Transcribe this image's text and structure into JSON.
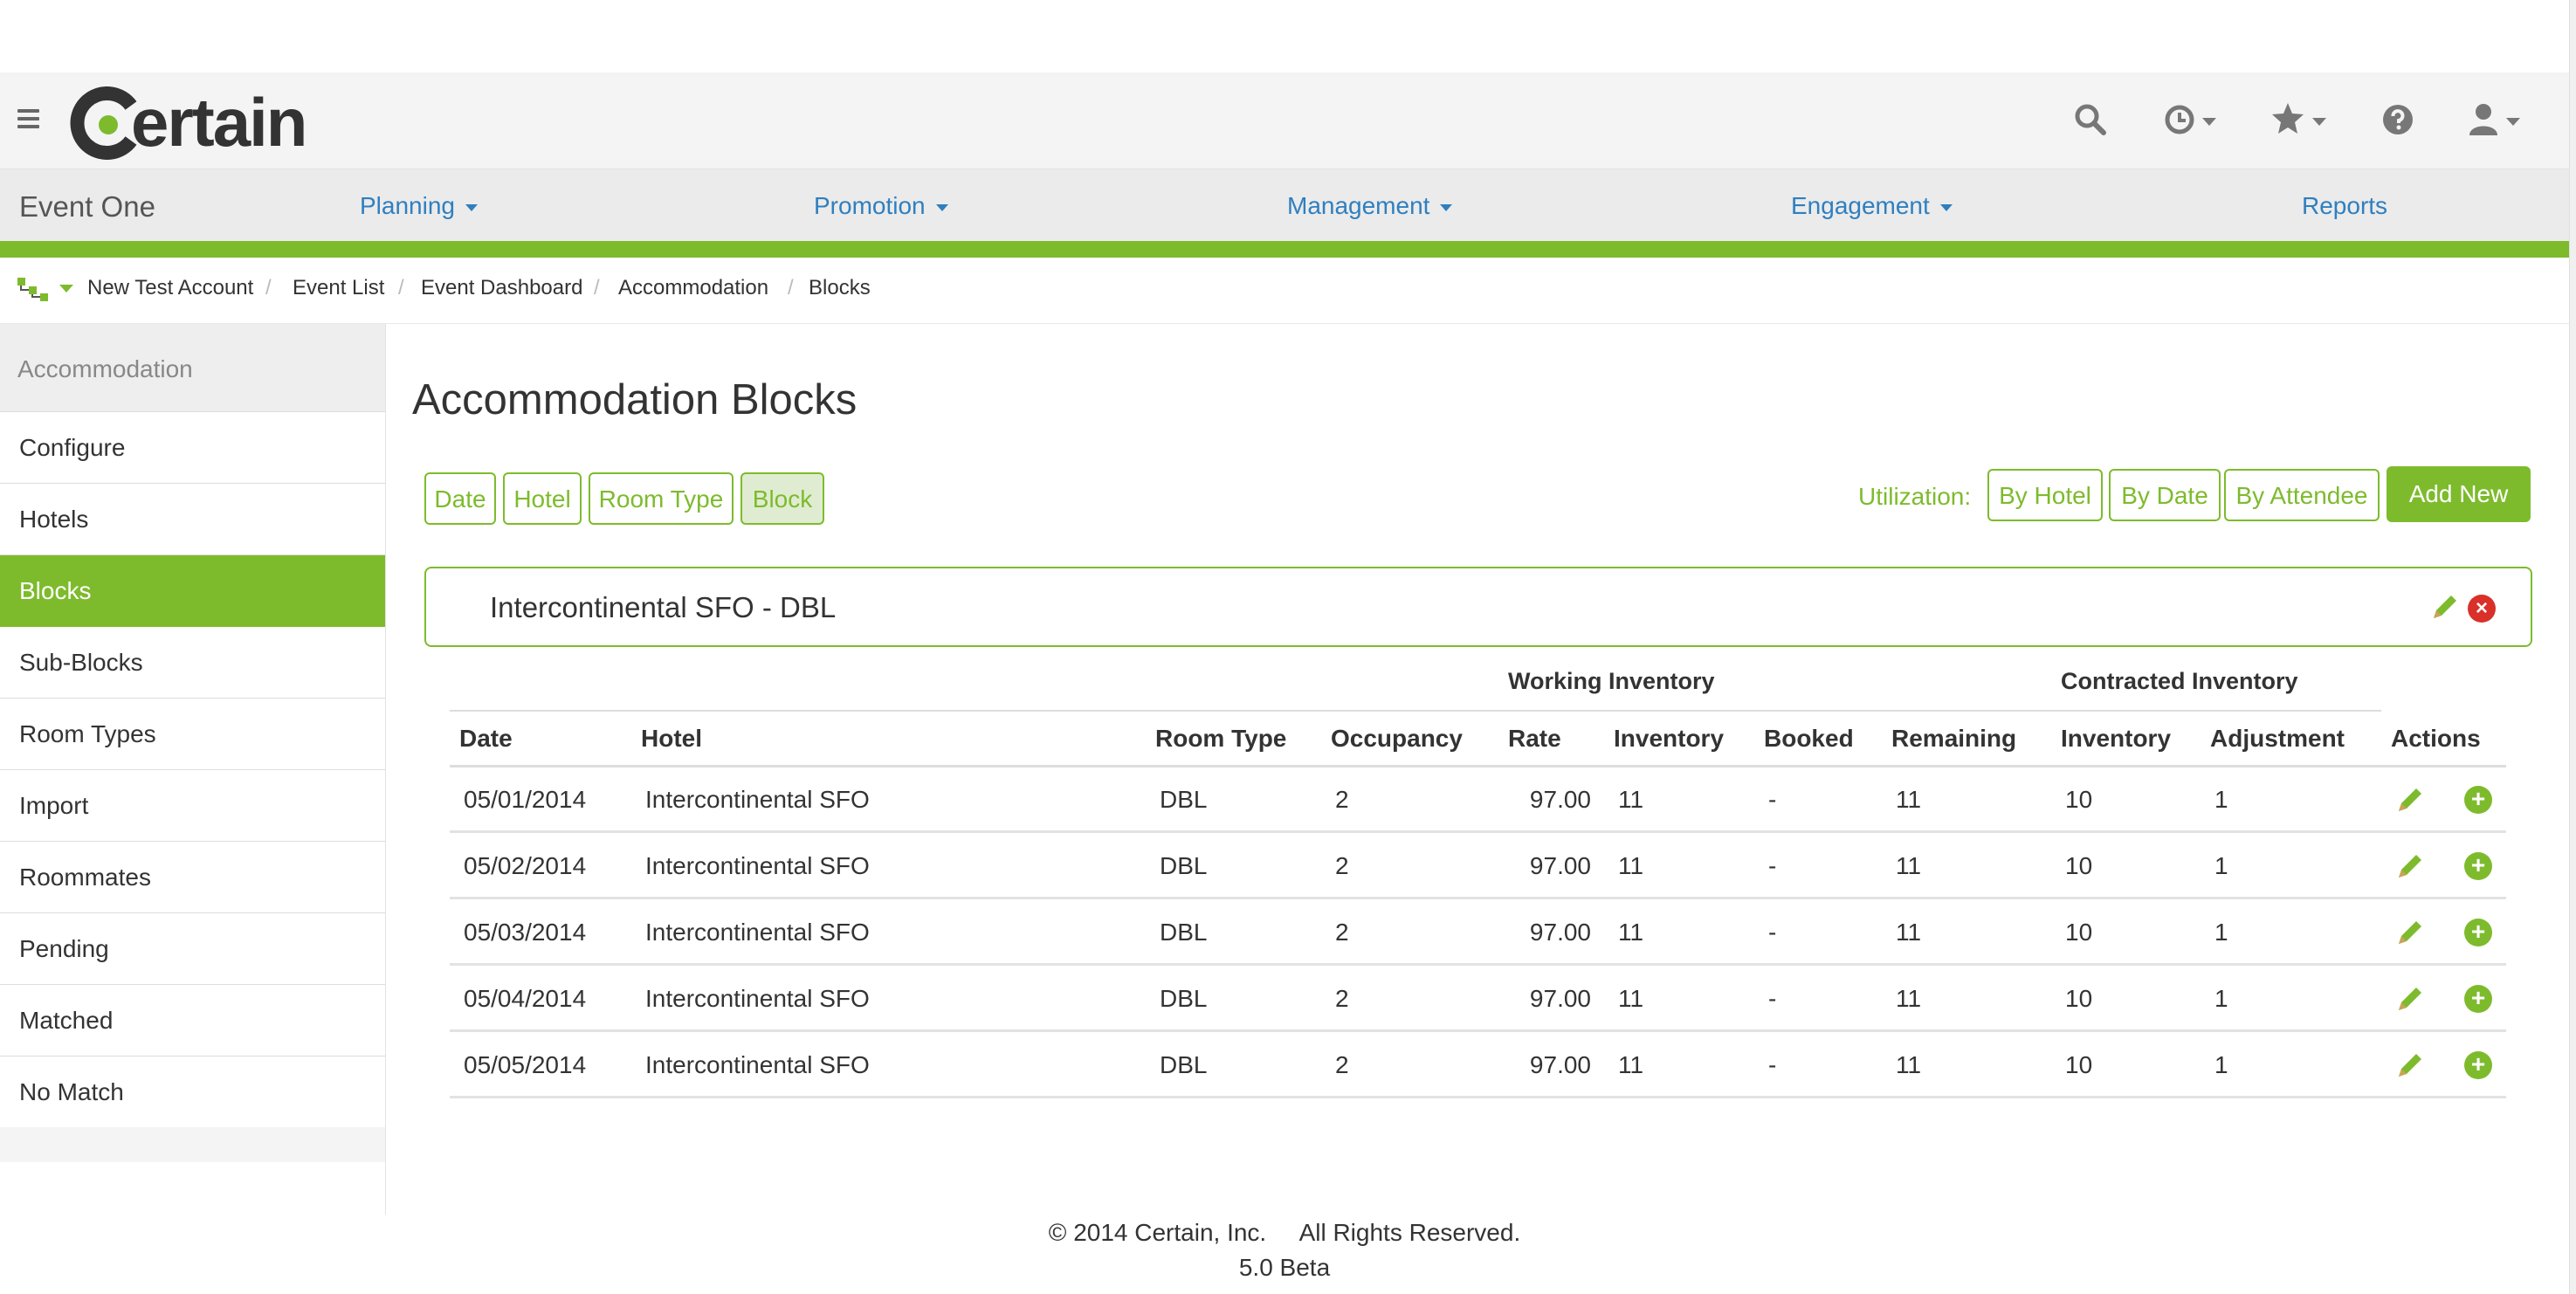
{
  "app": {
    "logo_text": "ertain",
    "brand_color": "#7dbb2d",
    "link_color": "#2f7fbf"
  },
  "header": {
    "icons": [
      "menu-icon",
      "search-icon",
      "history-icon",
      "star-icon",
      "help-icon",
      "user-icon"
    ]
  },
  "nav": {
    "event_name": "Event One",
    "items": [
      {
        "label": "Planning",
        "dropdown": true
      },
      {
        "label": "Promotion",
        "dropdown": true
      },
      {
        "label": "Management",
        "dropdown": true
      },
      {
        "label": "Engagement",
        "dropdown": true
      },
      {
        "label": "Reports",
        "dropdown": false
      }
    ]
  },
  "breadcrumb": {
    "items": [
      "New Test Account",
      "Event List",
      "Event Dashboard",
      "Accommodation",
      "Blocks"
    ],
    "separator": "/"
  },
  "sidebar": {
    "title": "Accommodation",
    "items": [
      {
        "label": "Configure"
      },
      {
        "label": "Hotels"
      },
      {
        "label": "Blocks",
        "active": true
      },
      {
        "label": "Sub-Blocks"
      },
      {
        "label": "Room Types"
      },
      {
        "label": "Import"
      },
      {
        "label": "Roommates"
      },
      {
        "label": "Pending"
      },
      {
        "label": "Matched"
      },
      {
        "label": "No Match"
      }
    ]
  },
  "main": {
    "title": "Accommodation Blocks",
    "filters": [
      {
        "label": "Date"
      },
      {
        "label": "Hotel"
      },
      {
        "label": "Room Type"
      },
      {
        "label": "Block",
        "selected": true
      }
    ],
    "utilization_label": "Utilization:",
    "utilization_buttons": [
      "By Hotel",
      "By Date",
      "By Attendee"
    ],
    "add_new_label": "Add New",
    "block_name": "Intercontinental SFO - DBL",
    "remove_symbol": "×",
    "add_symbol": "+"
  },
  "table": {
    "group_headers": [
      "Working Inventory",
      "Contracted Inventory"
    ],
    "columns": [
      "Date",
      "Hotel",
      "Room Type",
      "Occupancy",
      "Rate",
      "Inventory",
      "Booked",
      "Remaining",
      "Inventory",
      "Adjustment",
      "Actions"
    ],
    "rows": [
      [
        "05/01/2014",
        "Intercontinental SFO",
        "DBL",
        "2",
        "97.00",
        "11",
        "-",
        "11",
        "10",
        "1"
      ],
      [
        "05/02/2014",
        "Intercontinental SFO",
        "DBL",
        "2",
        "97.00",
        "11",
        "-",
        "11",
        "10",
        "1"
      ],
      [
        "05/03/2014",
        "Intercontinental SFO",
        "DBL",
        "2",
        "97.00",
        "11",
        "-",
        "11",
        "10",
        "1"
      ],
      [
        "05/04/2014",
        "Intercontinental SFO",
        "DBL",
        "2",
        "97.00",
        "11",
        "-",
        "11",
        "10",
        "1"
      ],
      [
        "05/05/2014",
        "Intercontinental SFO",
        "DBL",
        "2",
        "97.00",
        "11",
        "-",
        "11",
        "10",
        "1"
      ]
    ]
  },
  "footer": {
    "copyright": "© 2014 Certain, Inc.     All Rights Reserved.",
    "version": "5.0 Beta"
  }
}
